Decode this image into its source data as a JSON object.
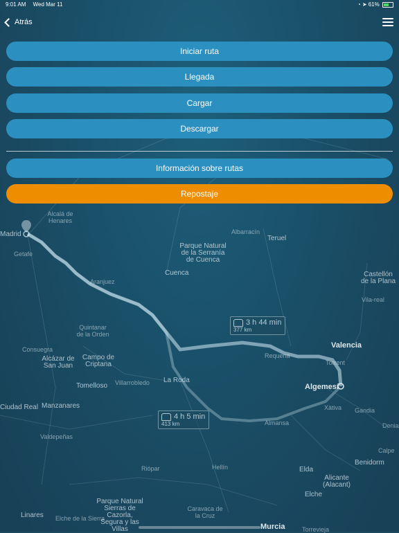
{
  "status_bar": {
    "time": "9:01 AM",
    "date": "Wed Mar 11",
    "battery_text": "61%",
    "battery_level": 0.61
  },
  "header": {
    "back_label": "Atrás",
    "menu_icon": "hamburger-menu-icon"
  },
  "actions": {
    "start_route": "Iniciar ruta",
    "arrival": "Llegada",
    "load": "Cargar",
    "download": "Descargar",
    "route_info": "Información sobre rutas",
    "refuel": "Repostaje"
  },
  "colors": {
    "primary_button": "#2b90c0",
    "refuel_button": "#ef8d00"
  },
  "map": {
    "labels": {
      "madrid": "Madrid",
      "getafe": "Getafe",
      "alcala": "Alcalá de Henares",
      "aranjuez": "Aranjuez",
      "parque_serrania": "Parque Natural de la Serranía de Cuenca",
      "cuenca": "Cuenca",
      "teruel": "Teruel",
      "albarracin": "Albarracín",
      "castellon": "Castellón de la Plana",
      "vilarreal": "Vila-real",
      "valencia": "Valencia",
      "torrent": "Torrent",
      "algemesi": "Algemesí",
      "requena": "Requena",
      "quintanar": "Quintanar de la Orden",
      "consuegra": "Consuegra",
      "alcazar": "Alcázar de San Juan",
      "campo": "Campo de Criptana",
      "tomelloso": "Tomelloso",
      "villarrobledo": "Villarrobledo",
      "la_roda": "La Roda",
      "ciudad_real": "Ciudad Real",
      "manzanares": "Manzanares",
      "valdepenas": "Valdepeñas",
      "almansa": "Almansa",
      "xativa": "Xàtiva",
      "gandia": "Gandia",
      "denia": "Denia",
      "calpe": "Calpe",
      "benidorm": "Benidorm",
      "elda": "Elda",
      "alicante": "Alicante (Alacant)",
      "elche": "Elche",
      "murcia": "Murcia",
      "hellin": "Hellín",
      "caravaca": "Caravaca de la Cruz",
      "linares": "Linares",
      "parque_cazorla": "Parque Natural Sierras de Cazorla, Segura y las Villas",
      "torrevieja": "Torrevieja",
      "elche_sierra": "Elche de la Sierra",
      "riopar": "Riópar"
    },
    "route_main": {
      "time": "3 h 44 min",
      "distance": "377 km"
    },
    "route_alt": {
      "time": "4 h 5 min",
      "distance": "413 km"
    }
  }
}
